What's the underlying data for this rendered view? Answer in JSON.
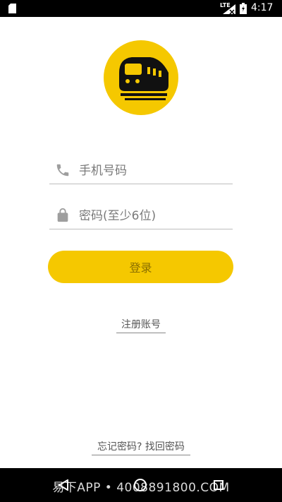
{
  "status_bar": {
    "network": "LTE",
    "time": "4:17"
  },
  "logo": {
    "icon": "train-icon",
    "bg_color": "#f5c800"
  },
  "form": {
    "phone": {
      "placeholder": "手机号码",
      "icon": "phone-icon"
    },
    "password": {
      "placeholder": "密码(至少6位)",
      "icon": "lock-icon"
    },
    "login_label": "登录",
    "accent": "#f5c800"
  },
  "links": {
    "register": "注册账号",
    "forgot": "忘记密码? 找回密码"
  },
  "watermark": "易下APP • 4008891800.COM"
}
